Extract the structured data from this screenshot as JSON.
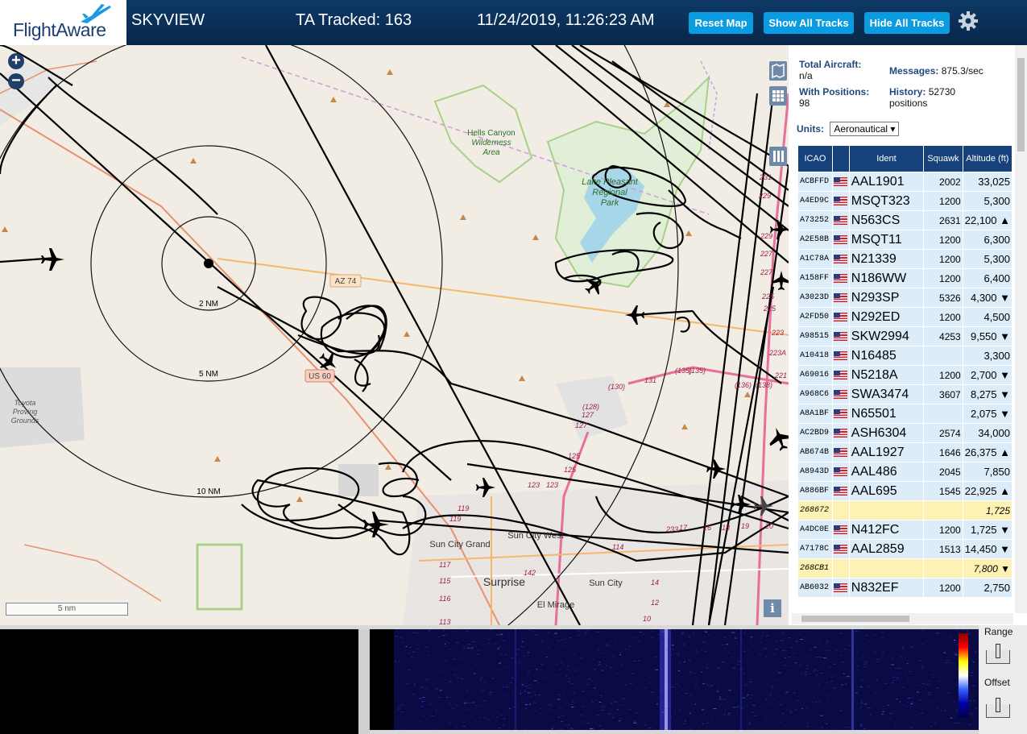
{
  "header": {
    "brand": "FlightAware",
    "app_title": "SKYVIEW",
    "tracked": "TA Tracked: 163",
    "datetime": "11/24/2019, 11:26:23 AM",
    "buttons": {
      "reset_map": "Reset Map",
      "show_all_tracks": "Show All Tracks",
      "hide_all_tracks": "Hide All Tracks"
    },
    "settings_icon": "gear-icon"
  },
  "map": {
    "zoom_in": "+",
    "zoom_out": "−",
    "scale_label": "5 nm",
    "info_label": "i",
    "range_rings": [
      "2 NM",
      "5 NM",
      "10 NM"
    ],
    "places": {
      "hells_canyon": [
        "Hells Canyon",
        "Wilderness",
        "Area"
      ],
      "lake_pleasant": [
        "Lake Pleasant",
        "Regional",
        "Park"
      ],
      "toyota": [
        "Toyota",
        "Proving",
        "Grounds"
      ],
      "sun_city_grand": "Sun City Grand",
      "sun_city_west": "Sun City West",
      "surprise": "Surprise",
      "sun_city": "Sun City",
      "el_mirage": "El Mirage"
    },
    "roads": {
      "az74": "AZ 74",
      "us60": "US 60"
    },
    "route_labels": [
      "(135)",
      "131",
      "(130)",
      "(128)",
      "127",
      "127",
      "125",
      "125",
      "123",
      "123",
      "119",
      "119",
      "117",
      "115",
      "116",
      "114",
      "113",
      "142",
      "14",
      "12",
      "10",
      "(136)",
      "(138)",
      "(135)",
      "221",
      "223",
      "223A",
      "225",
      "225",
      "227",
      "227",
      "229",
      "229",
      "231",
      "233",
      "17",
      "16",
      "18",
      "19",
      "20",
      "22"
    ],
    "controls": [
      "map-layers-icon",
      "grid-icon",
      "columns-icon"
    ]
  },
  "panel": {
    "total_aircraft_label": "Total Aircraft:",
    "total_aircraft_value": "n/a",
    "messages_label": "Messages:",
    "messages_value": "875.3/sec",
    "positions_label": "With Positions:",
    "positions_value": "98",
    "history_label": "History:",
    "history_value": "52730",
    "history_unit": "positions",
    "units_label": "Units:",
    "units_value": "Aeronautical ▾",
    "columns": [
      "ICAO",
      "",
      "Ident",
      "Squawk",
      "Altitude (ft)"
    ],
    "rows": [
      {
        "icao": "ACBFFD",
        "flag": true,
        "ident": "AAL1901",
        "squawk": "2002",
        "alt": "33,025",
        "noinfo": false
      },
      {
        "icao": "A4ED9C",
        "flag": true,
        "ident": "MSQT323",
        "squawk": "1200",
        "alt": "5,300",
        "noinfo": false
      },
      {
        "icao": "A73252",
        "flag": true,
        "ident": "N563CS",
        "squawk": "2631",
        "alt": "22,100 ▲",
        "noinfo": false
      },
      {
        "icao": "A2E58B",
        "flag": true,
        "ident": "MSQT11",
        "squawk": "1200",
        "alt": "6,300",
        "noinfo": false
      },
      {
        "icao": "A1C78A",
        "flag": true,
        "ident": "N21339",
        "squawk": "1200",
        "alt": "5,300",
        "noinfo": false
      },
      {
        "icao": "A158FF",
        "flag": true,
        "ident": "N186WW",
        "squawk": "1200",
        "alt": "6,400",
        "noinfo": false
      },
      {
        "icao": "A3023D",
        "flag": true,
        "ident": "N293SP",
        "squawk": "5326",
        "alt": "4,300 ▼",
        "noinfo": false
      },
      {
        "icao": "A2FD50",
        "flag": true,
        "ident": "N292ED",
        "squawk": "1200",
        "alt": "4,500",
        "noinfo": false
      },
      {
        "icao": "A98515",
        "flag": true,
        "ident": "SKW2994",
        "squawk": "4253",
        "alt": "9,550 ▼",
        "noinfo": false
      },
      {
        "icao": "A10418",
        "flag": true,
        "ident": "N16485",
        "squawk": "",
        "alt": "3,300",
        "noinfo": false
      },
      {
        "icao": "A69016",
        "flag": true,
        "ident": "N5218A",
        "squawk": "1200",
        "alt": "2,700 ▼",
        "noinfo": false
      },
      {
        "icao": "A968C6",
        "flag": true,
        "ident": "SWA3474",
        "squawk": "3607",
        "alt": "8,275 ▼",
        "noinfo": false
      },
      {
        "icao": "A8A1BF",
        "flag": true,
        "ident": "N65501",
        "squawk": "",
        "alt": "2,075 ▼",
        "noinfo": false
      },
      {
        "icao": "AC2BD9",
        "flag": true,
        "ident": "ASH6304",
        "squawk": "2574",
        "alt": "34,000",
        "noinfo": false
      },
      {
        "icao": "AB674B",
        "flag": true,
        "ident": "AAL1927",
        "squawk": "1646",
        "alt": "26,375 ▲",
        "noinfo": false
      },
      {
        "icao": "A8943D",
        "flag": true,
        "ident": "AAL486",
        "squawk": "2045",
        "alt": "7,850",
        "noinfo": false
      },
      {
        "icao": "A886BF",
        "flag": true,
        "ident": "AAL695",
        "squawk": "1545",
        "alt": "22,925 ▲",
        "noinfo": false
      },
      {
        "icao": "268672",
        "flag": false,
        "ident": "",
        "squawk": "",
        "alt": "1,725",
        "noinfo": true
      },
      {
        "icao": "A4DC0E",
        "flag": true,
        "ident": "N412FC",
        "squawk": "1200",
        "alt": "1,725 ▼",
        "noinfo": false
      },
      {
        "icao": "A7178C",
        "flag": true,
        "ident": "AAL2859",
        "squawk": "1513",
        "alt": "14,450 ▼",
        "noinfo": false
      },
      {
        "icao": "268CB1",
        "flag": false,
        "ident": "",
        "squawk": "",
        "alt": "7,800 ▼",
        "noinfo": true
      },
      {
        "icao": "AB6032",
        "flag": true,
        "ident": "N832EF",
        "squawk": "1200",
        "alt": "2,750",
        "noinfo": false
      }
    ]
  },
  "waterfall": {
    "range_label": "Range",
    "offset_label": "Offset"
  },
  "colors": {
    "header_bg": "#0b3360",
    "button_bg": "#0a9be0",
    "table_header": "#17417a",
    "row_bg": "#dcecf8",
    "noinfo_row": "#fdf1b3"
  }
}
